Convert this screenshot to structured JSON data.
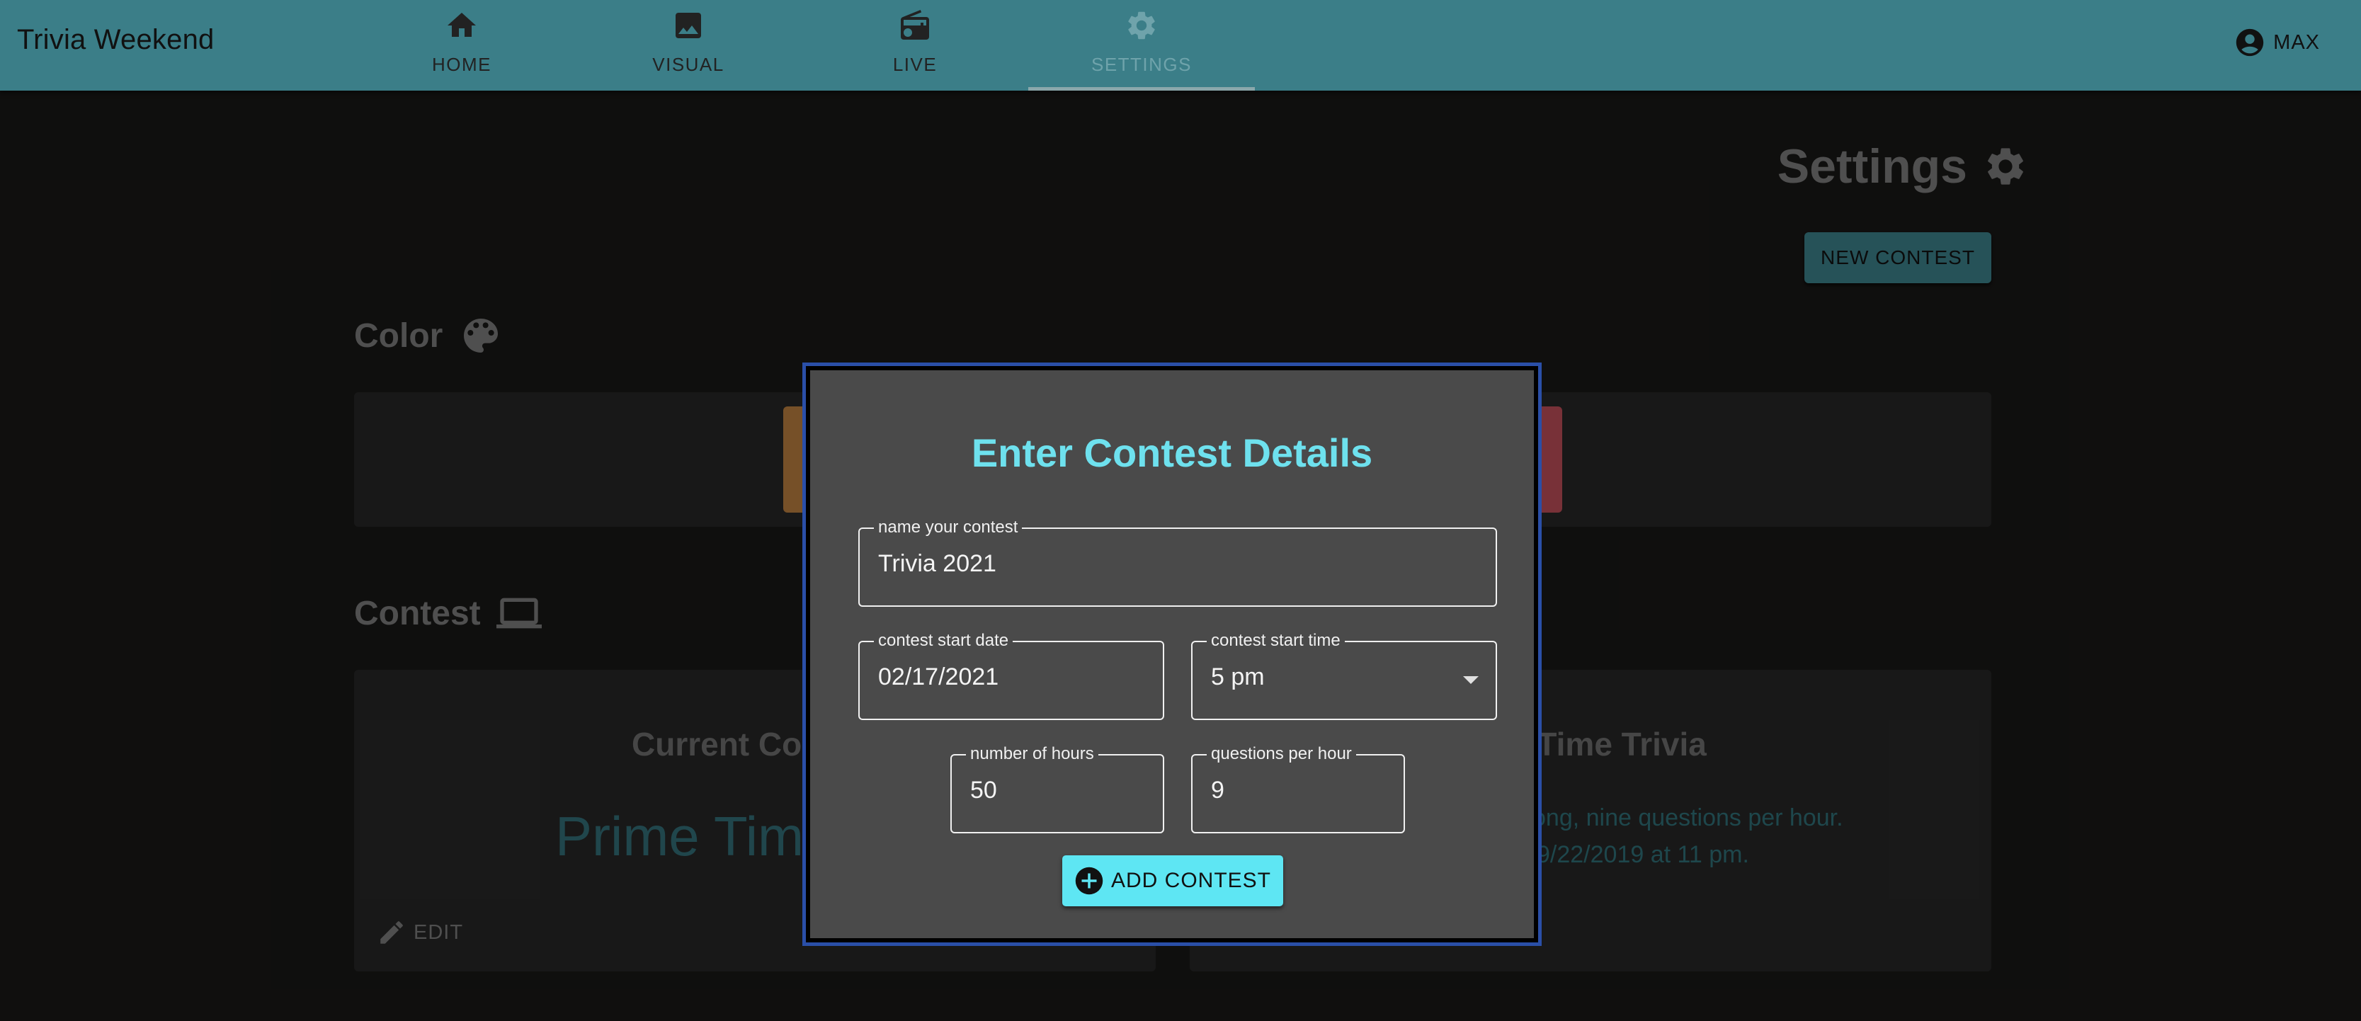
{
  "app": {
    "title": "Trivia Weekend"
  },
  "nav": {
    "tabs": [
      {
        "label": "HOME",
        "icon": "home-icon"
      },
      {
        "label": "VISUAL",
        "icon": "image-icon"
      },
      {
        "label": "LIVE",
        "icon": "radio-icon"
      },
      {
        "label": "SETTINGS",
        "icon": "gear-icon",
        "active": true
      }
    ]
  },
  "user": {
    "name": "MAX",
    "icon": "account-circle-icon"
  },
  "page": {
    "title": "Settings",
    "new_contest_label": "NEW CONTEST",
    "color_section": {
      "heading": "Color",
      "icon": "palette-icon"
    },
    "contest_section": {
      "heading": "Contest",
      "icon": "laptop-icon"
    }
  },
  "cards": {
    "current": {
      "title_visible": "Current Co",
      "name_visible": "Prime Time",
      "edit_label": "EDIT"
    },
    "next": {
      "title_visible": "e Time Trivia",
      "line1_visible": "ong, nine questions per hour.",
      "line2_visible": "9/22/2019 at 11 pm."
    }
  },
  "dialog": {
    "title": "Enter Contest Details",
    "name_field": {
      "label": "name your contest",
      "value": "Trivia 2021"
    },
    "date_field": {
      "label": "contest start date",
      "value": "02/17/2021"
    },
    "time_field": {
      "label": "contest start time",
      "value": "5 pm"
    },
    "hours_field": {
      "label": "number of hours",
      "value": "50"
    },
    "qph_field": {
      "label": "questions per hour",
      "value": "9"
    },
    "add_button_label": "ADD CONTEST"
  },
  "colors": {
    "appbar": "#3b7e88",
    "accent": "#5ee6f3",
    "dialog_title": "#6ee1ee",
    "swatch_left": "#b57b3e",
    "swatch_right": "#b84c56",
    "dialog_border": "#2a4fa8"
  }
}
